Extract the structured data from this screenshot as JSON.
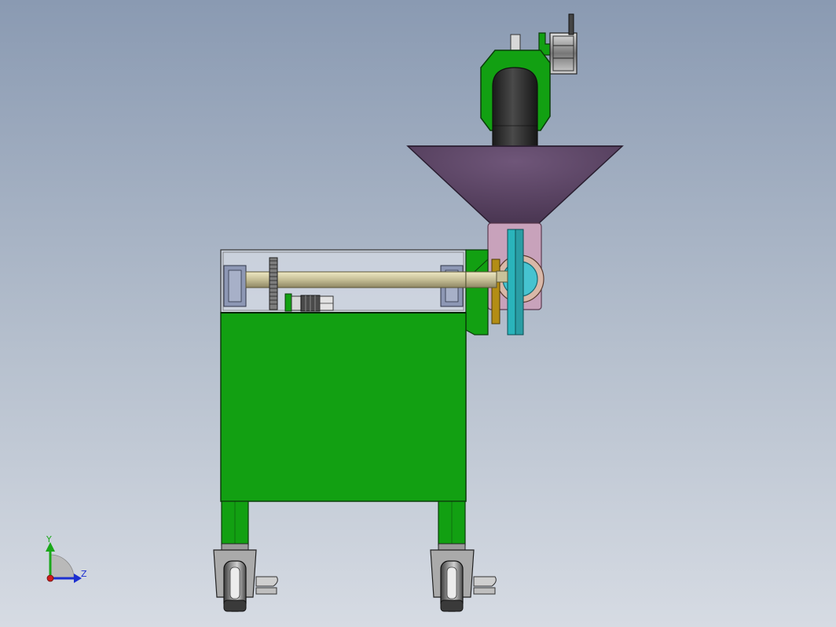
{
  "view": {
    "background_top": "#8a9ab2",
    "background_bottom": "#d6dbe3"
  },
  "triad": {
    "y_label": "Y",
    "z_label": "Z",
    "y_color": "#1aa81a",
    "z_color": "#1c2fd0",
    "x_color": "#d01c1c"
  },
  "colors": {
    "frame_green": "#12a012",
    "frame_edge": "#0b3d0b",
    "hopper": "#5e4766",
    "hopper_dark": "#3a2a42",
    "shaft": "#c9c29a",
    "glass": "#e4e8ef",
    "bearing_block": "#8d97b4",
    "cyan_plate": "#2ab4bb",
    "gold_plate": "#b38d15",
    "pink_tube": "#c8a2bb",
    "wheel_grey": "#8a8a8a",
    "wheel_dark": "#3a3a3a",
    "feed_tube": "#2b2b2b"
  }
}
